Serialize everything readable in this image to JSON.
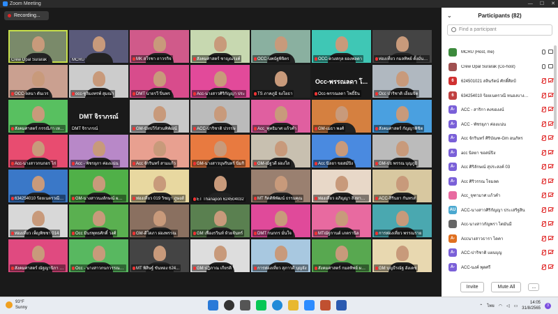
{
  "window": {
    "title": "Zoom Meeting"
  },
  "recording": {
    "label": "Recording..."
  },
  "tiles": [
    {
      "name": "Crew Opal Surarak",
      "bg": "#7a8a6a",
      "active": true,
      "muted": false
    },
    {
      "name": "MCRU",
      "bg": "#5a5a7a",
      "muted": false
    },
    {
      "name": "MK สโรชา ถาวรกิจ",
      "bg": "#d05a8a",
      "muted": true
    },
    {
      "name": "สังคมศาสตร์ ชาญณรงค์",
      "bg": "#c7d8b0",
      "muted": true
    },
    {
      "name": "OCC-นพนัฐพิจิตร",
      "bg": "#8ab0a0",
      "muted": true
    },
    {
      "name": "OCC-ดวงสกุล ยองพลดา",
      "bg": "#3fc7b5",
      "muted": true
    },
    {
      "name": "ท่องเที่ยว กมลทิพย์ ตั้งมั่นสกุล",
      "bg": "#444",
      "muted": true
    },
    {
      "name": "OCC-ลลนา ดันเวร",
      "bg": "#caa090",
      "muted": true
    },
    {
      "name": "occ-ซูลิมงทรพ์ สุมณา",
      "bg": "#ccc",
      "muted": true
    },
    {
      "name": "DMT นายรวี ปิ่นพร",
      "bg": "#d84c8c",
      "muted": true
    },
    {
      "name": "Acc-นางสาวศิริกัญญา ประ",
      "bg": "#e24a9a",
      "muted": true
    },
    {
      "name": "TS ภาคภูมิ จงโยธา",
      "bg": "#222",
      "muted": true
    },
    {
      "name": "Occ-พรรณลดา โพธิ์ธิน",
      "bg": "#1a1a1a",
      "big": "Occ-พรรณลดา โ...",
      "muted": true
    },
    {
      "name": "Occ ปาริชาติ เอี่ยมจิต",
      "bg": "#b0b8c0",
      "muted": true
    },
    {
      "name": "สังคมศาสตร์ กรรณิภา เหล็กเมฆ",
      "bg": "#58c060",
      "muted": true
    },
    {
      "name": "DMT จิราภรณ์",
      "bg": "#1a1a1a",
      "big": "DMT จิราภรณ์",
      "muted": false
    },
    {
      "name": "GM-นัทปวีร์ส่วนพิพัฒน์",
      "bg": "#c8c8c8",
      "muted": true
    },
    {
      "name": "ACC-ปาริชาติ ปวรรษ",
      "bg": "#bbb",
      "muted": true
    },
    {
      "name": "Acc_พุทธิมาศ แก้วคำ",
      "bg": "#e05fa0",
      "muted": true
    },
    {
      "name": "GM-เมธา พงศ์",
      "bg": "#d58040",
      "muted": true
    },
    {
      "name": "สังคมศาสตร์ กัญญาพิชิต",
      "bg": "#4aa0e0",
      "muted": true
    },
    {
      "name": "Acc-นางสาวกนกอร ไก่",
      "bg": "#e84c70",
      "muted": true
    },
    {
      "name": "Acc - พัชรยุภา ค่องแน่น",
      "bg": "#b888c8",
      "muted": true
    },
    {
      "name": "Acc จักรินทร์ สามแก้ว",
      "bg": "#e8a090",
      "muted": true
    },
    {
      "name": "GM-นางสาวบุษรินทร์ นิ่มกิ",
      "bg": "#e87a40",
      "muted": true
    },
    {
      "name": "GM-ณัฐวดี ผ่องใส",
      "bg": "#c8c0b0",
      "muted": true
    },
    {
      "name": "Acc นิลยา ขอสม์ปิง",
      "bg": "#4a8ae0",
      "muted": true
    },
    {
      "name": "GM-ปธ พรรณ บุญภูมิ",
      "bg": "#bbb",
      "muted": true
    },
    {
      "name": "634254010 ร้อยเนตรวณี เนียวภาสะวะ",
      "bg": "#3a78c8",
      "muted": true
    },
    {
      "name": "GM-นางสาวนงลักษณ์ ผยโยรง",
      "bg": "#50b048",
      "muted": true
    },
    {
      "name": "ท่องเที่ยว 019 วิชญา ภูษงส์",
      "bg": "#e8d8a0",
      "muted": true
    },
    {
      "name": "ET Thanapon 624504032",
      "bg": "#1a1a1a",
      "muted": true
    },
    {
      "name": "MT กิตติพิพัฒน์ ธรรมคุณ",
      "bg": "#9a8070",
      "muted": true
    },
    {
      "name": "ท่องเที่ยว อภิญญา สิงหาทอง",
      "bg": "#e8d8c8",
      "muted": true
    },
    {
      "name": "ACC-สิรินยา กันทรส",
      "bg": "#d8c8a0",
      "muted": true
    },
    {
      "name": "ท่องเที่ยว เพ็ญพิชชา 014",
      "bg": "#d8d8d8",
      "muted": true
    },
    {
      "name": "Occ มินรพุทธศักดิ์ วงศ์",
      "bg": "#5ab050",
      "muted": true
    },
    {
      "name": "GM-ดีโดภา ผ่องพรรณ",
      "bg": "#8a7060",
      "muted": true
    },
    {
      "name": "GM เฟื่องรวินท์ ห้วยจันทร์",
      "bg": "#5a8050",
      "muted": true
    },
    {
      "name": "DMT กนกกร มั่นใจ",
      "bg": "#e04a9a",
      "muted": true
    },
    {
      "name": "MTณัฐกานต์ เภตรานิล",
      "bg": "#e86aa0",
      "muted": true
    },
    {
      "name": "การท่องเที่ยว พรรณราย",
      "bg": "#4aa8b0",
      "muted": true
    },
    {
      "name": "สังคมศาสตร์ ณัฐญานิกา มณีรัตน์",
      "bg": "#e04a80",
      "muted": true
    },
    {
      "name": "Occ - นางสาวกนกวรรณ หิม",
      "bg": "#58b860",
      "muted": true
    },
    {
      "name": "MT พิสิษฐ์ ขันทอง 624...",
      "bg": "#444",
      "muted": true
    },
    {
      "name": "GM ปฏิภาณ เกียรติ",
      "bg": "#ddd",
      "muted": true
    },
    {
      "name": "การท่องเที่ยว สุภาวดี บุญจัง",
      "bg": "#a8c8e0",
      "muted": true
    },
    {
      "name": "สังคมศาสตร์ กมลทิพย์ ผกานนท์",
      "bg": "#58a850",
      "muted": true
    },
    {
      "name": "GM บุญธีรณัฐ ฮังเดช",
      "bg": "#e8d8b0",
      "muted": true
    }
  ],
  "participants": {
    "title": "Participants (82)",
    "search_placeholder": "Find a participant",
    "invite_label": "Invite",
    "mute_all_label": "Mute All",
    "more_label": "...",
    "list": [
      {
        "initials": "",
        "name": "MCRU (Host, me)",
        "color": "#3c8a3c",
        "state": "on"
      },
      {
        "initials": "",
        "name": "Crew Opal Surarak (Co-host)",
        "color": "#a05050",
        "state": "on"
      },
      {
        "initials": "6",
        "name": "624501021 สลินรัตน์ ศักดิ์ศิลป์",
        "color": "#d03030",
        "state": "off"
      },
      {
        "initials": "6",
        "name": "634254010 ร้อยเนตรวณี หนองบางนรองค์",
        "color": "#c04040",
        "state": "off"
      },
      {
        "initials": "A-",
        "name": "ACC - สาริกา คงของงน์",
        "color": "#7a60d8",
        "state": "off"
      },
      {
        "initials": "A-",
        "name": "ACC - พัชรยุภา ค่องแน่น",
        "color": "#7a60d8",
        "state": "off"
      },
      {
        "initials": "A-",
        "name": "Acc จักรินทร์ ศิริบัณฑ-Gm อนภัทร",
        "color": "#7a60d8",
        "state": "off"
      },
      {
        "initials": "A-",
        "name": "acc นิลยา ขอสม์ปิง",
        "color": "#7a60d8",
        "state": "off"
      },
      {
        "initials": "A-",
        "name": "Acc ศิริลักษณ์ สุประสงค์ 03",
        "color": "#7a60d8",
        "state": "off"
      },
      {
        "initials": "A-",
        "name": "Acc ศิริวรรณ โจมลด",
        "color": "#7a60d8",
        "state": "off"
      },
      {
        "initials": "",
        "name": "Acc_จุฑามาศ แก้วคำ",
        "color": "#e86aa0",
        "state": "off"
      },
      {
        "initials": "AU",
        "name": "ACC-นางสาวศิริกัญญา ประเสริฐสิน",
        "color": "#4aa8d0",
        "state": "off"
      },
      {
        "initials": "",
        "name": "Acc-นางสาวกัญพรา ไตมันมี",
        "color": "#666",
        "state": "off"
      },
      {
        "initials": "A-",
        "name": "Accนางสาวธารา ไดคา",
        "color": "#e07020",
        "state": "off"
      },
      {
        "initials": "A-",
        "name": "ACC-ปาริชาติ แผนบุญ",
        "color": "#7a60d8",
        "state": "off"
      },
      {
        "initials": "A-",
        "name": "ACC-นงค์ พุดศรี",
        "color": "#7a60d8",
        "state": "off"
      }
    ]
  },
  "taskbar": {
    "temp": "93°F",
    "weather": "Sunny",
    "lang": "ไทย",
    "time": "14:05",
    "date": "31/8/2565",
    "notif_count": "3"
  }
}
